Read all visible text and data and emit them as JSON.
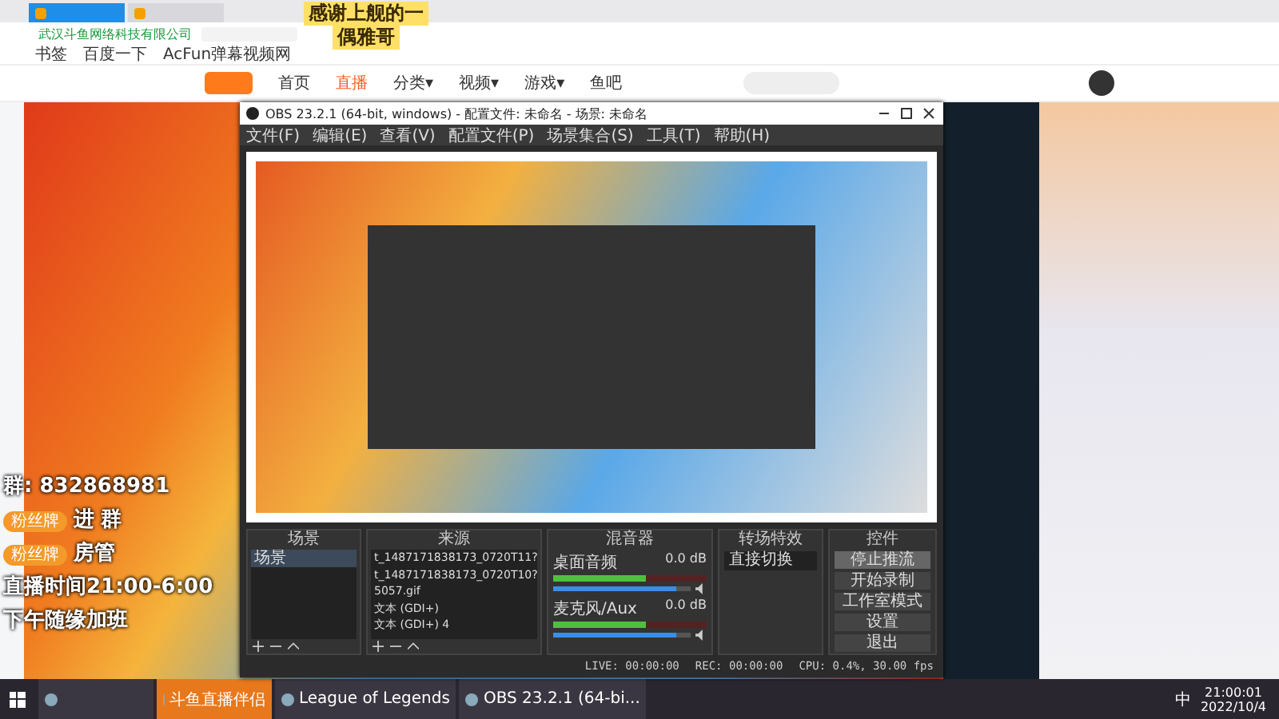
{
  "browser": {
    "tabs": [
      {
        "selected": true
      },
      {
        "selected": false
      }
    ],
    "address": {
      "cert": "武汉斗鱼网络科技有限公司"
    },
    "bookmarks": [
      "书签",
      "百度一下",
      "AcFun弹幕视频网"
    ],
    "nav": [
      {
        "label": "首页",
        "selected": false
      },
      {
        "label": "直播",
        "selected": true
      },
      {
        "label": "分类▾",
        "selected": false
      },
      {
        "label": "视频▾",
        "selected": false
      },
      {
        "label": "游戏▾",
        "selected": false
      },
      {
        "label": "鱼吧",
        "selected": false
      }
    ],
    "sticker": {
      "line1": "感谢上舰的一",
      "line2": "偶雅哥"
    }
  },
  "obs": {
    "title": "OBS 23.2.1 (64-bit, windows) - 配置文件: 未命名 - 场景: 未命名",
    "menu": [
      "文件(F)",
      "编辑(E)",
      "查看(V)",
      "配置文件(P)",
      "场景集合(S)",
      "工具(T)",
      "帮助(H)"
    ],
    "docks": {
      "scenes": "场景",
      "sources": "来源",
      "mixer": "混音器",
      "transitions": "转场特效",
      "controls": "控件"
    },
    "scenes": [
      {
        "label": "场景",
        "selected": true
      }
    ],
    "sources": [
      "t_1487171838173_0720T11?",
      "t_1487171838173_0720T10?",
      "5057.gif",
      "文本 (GDI+)",
      "文本 (GDI+) 4"
    ],
    "channels": [
      {
        "name": "桌面音频",
        "reading": "0.0 dB",
        "level": 0.6,
        "volume": {
          "level": 0.9
        }
      },
      {
        "name": "麦克风/Aux",
        "reading": "0.0 dB",
        "level": 0.6,
        "volume": {
          "level": 0.9
        }
      }
    ],
    "transition": "直接切换",
    "controls": [
      {
        "label": "停止推流",
        "selected": true
      },
      {
        "label": "开始录制",
        "selected": false
      },
      {
        "label": "工作室模式",
        "selected": false
      },
      {
        "label": "设置",
        "selected": false
      },
      {
        "label": "退出",
        "selected": false
      }
    ],
    "status": [
      "LIVE: 00:00:00",
      "REC: 00:00:00",
      "CPU: 0.4%, 30.00 fps"
    ]
  },
  "overlay": {
    "group": "群: 832868981",
    "rows": [
      {
        "badge": "粉丝牌",
        "text": "进",
        "suffix": "群"
      },
      {
        "badge": "粉丝牌",
        "text": "房管"
      }
    ],
    "schedule": "直播时间21:00-6:00",
    "note": "下午随缘加班"
  },
  "taskbar": {
    "items": [
      {
        "selected": false
      },
      {
        "label": "斗鱼直播伴侣",
        "selected": true
      },
      {
        "label": "League of Legends",
        "selected": false
      },
      {
        "label": "OBS 23.2.1 (64-bi...",
        "selected": false
      }
    ],
    "ime": "中",
    "time": "21:00:01",
    "date": "2022/10/4"
  }
}
